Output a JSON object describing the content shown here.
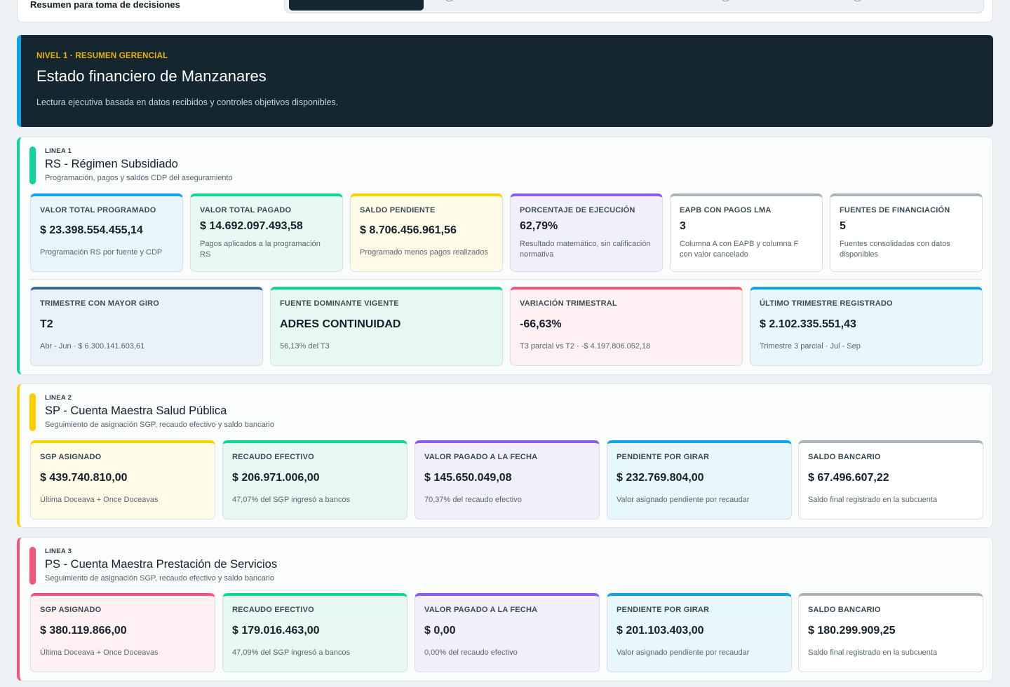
{
  "header": {
    "subtitle": "Resumen para toma de decisiones"
  },
  "hero": {
    "eyebrow": "NIVEL 1 · RESUMEN GERENCIAL",
    "title": "Estado financiero de Manzanares",
    "description": "Lectura ejecutiva basada en datos recibidos y controles objetivos disponibles."
  },
  "lines": [
    {
      "tag": "LINEA 1",
      "title": "RS - Régimen Subsidiado",
      "subtitle": "Programación, pagos y saldos CDP del aseguramiento",
      "accent": "#10d49a",
      "cards": [
        {
          "label": "VALOR TOTAL PROGRAMADO",
          "value": "$ 23.398.554.455,14",
          "note": "Programación RS por fuente y CDP"
        },
        {
          "label": "VALOR TOTAL PAGADO",
          "value": "$ 14.692.097.493,58",
          "note": "Pagos aplicados a la programación RS"
        },
        {
          "label": "SALDO PENDIENTE",
          "value": "$ 8.706.456.961,56",
          "note": "Programado menos pagos realizados"
        },
        {
          "label": "PORCENTAJE DE EJECUCIÓN",
          "value": "62,79%",
          "note": "Resultado matemático, sin calificación normativa"
        },
        {
          "label": "EAPB CON PAGOS LMA",
          "value": "3",
          "note": "Columna A con EAPB y columna F con valor cancelado"
        },
        {
          "label": "FUENTES DE FINANCIACIÓN",
          "value": "5",
          "note": "Fuentes consolidadas con datos disponibles"
        }
      ],
      "cards2": [
        {
          "label": "TRIMESTRE CON MAYOR GIRO",
          "value": "T2",
          "note": "Abr - Jun · $ 6.300.141.603,61"
        },
        {
          "label": "FUENTE DOMINANTE VIGENTE",
          "value": "ADRES CONTINUIDAD",
          "note": "56,13% del T3"
        },
        {
          "label": "VARIACIÓN TRIMESTRAL",
          "value": "-66,63%",
          "note": "T3 parcial vs T2 · -$ 4.197.806.052,18"
        },
        {
          "label": "ÚLTIMO TRIMESTRE REGISTRADO",
          "value": "$ 2.102.335.551,43",
          "note": "Trimestre 3 parcial · Jul - Sep"
        }
      ]
    },
    {
      "tag": "LINEA 2",
      "title": "SP - Cuenta Maestra Salud Pública",
      "subtitle": "Seguimiento de asignación SGP, recaudo efectivo y saldo bancario",
      "accent": "#fad000",
      "cards": [
        {
          "label": "SGP ASIGNADO",
          "value": "$ 439.740.810,00",
          "note": "Última Doceava + Once Doceavas"
        },
        {
          "label": "RECAUDO EFECTIVO",
          "value": "$ 206.971.006,00",
          "note": "47,07% del SGP ingresó a bancos"
        },
        {
          "label": "VALOR PAGADO A LA FECHA",
          "value": "$ 145.650.049,08",
          "note": "70,37% del recaudo efectivo"
        },
        {
          "label": "PENDIENTE POR GIRAR",
          "value": "$ 232.769.804,00",
          "note": "Valor asignado pendiente por recaudar"
        },
        {
          "label": "SALDO BANCARIO",
          "value": "$ 67.496.607,22",
          "note": "Saldo final registrado en la subcuenta"
        }
      ]
    },
    {
      "tag": "LINEA 3",
      "title": "PS - Cuenta Maestra Prestación de Servicios",
      "subtitle": "Seguimiento de asignación SGP, recaudo efectivo y saldo bancario",
      "accent": "#f0577b",
      "cards": [
        {
          "label": "SGP ASIGNADO",
          "value": "$ 380.119.866,00",
          "note": "Última Doceava + Once Doceavas"
        },
        {
          "label": "RECAUDO EFECTIVO",
          "value": "$ 179.016.463,00",
          "note": "47,09% del SGP ingresó a bancos"
        },
        {
          "label": "VALOR PAGADO A LA FECHA",
          "value": "$ 0,00",
          "note": "0,00% del recaudo efectivo"
        },
        {
          "label": "PENDIENTE POR GIRAR",
          "value": "$ 201.103.403,00",
          "note": "Valor asignado pendiente por recaudar"
        },
        {
          "label": "SALDO BANCARIO",
          "value": "$ 180.299.909,25",
          "note": "Saldo final registrado en la subcuenta"
        }
      ]
    }
  ]
}
